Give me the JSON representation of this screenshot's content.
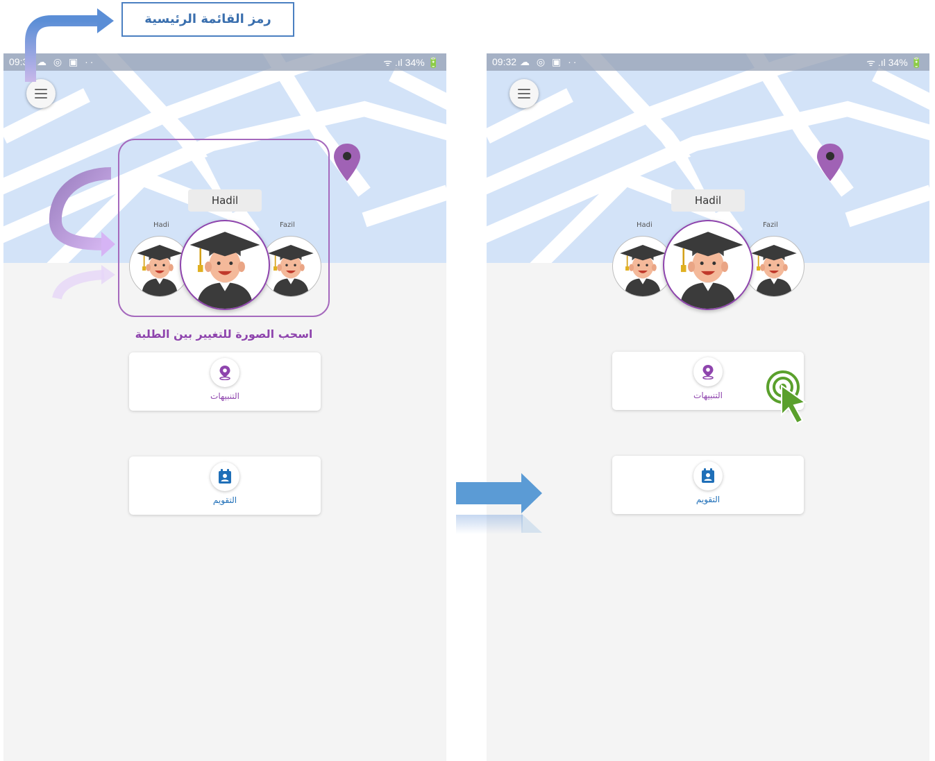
{
  "annotations": {
    "menu_icon_label": "رمز القائمة الرئيسية",
    "swipe_hint": "اسحب الصورة للتغيير بين الطلبة"
  },
  "left_screen": {
    "status": {
      "time": "09:3",
      "icons": "☁ ◎ ▣ ··",
      "right": "ᯤ .ıl 34% 🔋"
    },
    "current_student": "Hadil",
    "student_left": "Hadi",
    "student_right": "Fazil",
    "cards": {
      "alerts": "التنبيهات",
      "calendar": "التقويم"
    }
  },
  "right_screen": {
    "status": {
      "time": "09:32",
      "icons": "☁ ◎ ▣ ··",
      "right": "ᯤ .ıl 34% 🔋"
    },
    "current_student": "Hadil",
    "student_left": "Hadi",
    "student_right": "Fazil",
    "cards": {
      "alerts": "التنبيهات",
      "calendar": "التقويم"
    }
  },
  "colors": {
    "accent_purple": "#8e44ad",
    "map_background": "#d3e3f8",
    "annotation_blue": "#4a7fc1",
    "cursor_green": "#5aa02c",
    "calendar_blue": "#1f6fb8"
  }
}
